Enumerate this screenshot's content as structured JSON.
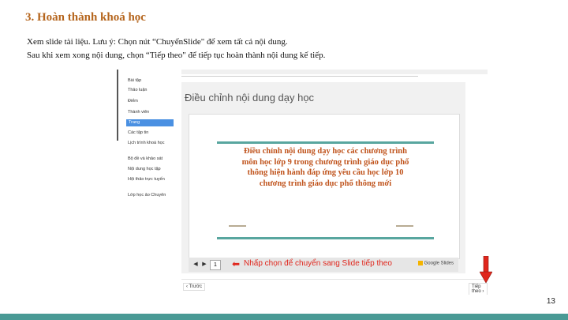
{
  "slide": {
    "title": "3. Hoàn thành khoá học",
    "instruction_1": "Xem slide tài liệu. Lưu ý: Chọn nút “ChuyểnSlide\" để xem tất cả nội dung.",
    "instruction_2": "Sau khi xem xong nội dung, chọn “Tiếp theo\" để tiếp tục hoàn thành nội dung kế tiếp.",
    "page_number": "13"
  },
  "sidebar": {
    "items": [
      "Bài tập",
      "Thảo luận",
      "Điểm",
      "Thành viên",
      "Trang",
      "Các tập tin",
      "Lịch trình khoá học",
      "Bộ đề và khảo sát",
      "Nội dung học tập",
      "Hội thảo trực tuyến",
      "Lớp học ảo Chuyên"
    ],
    "active_index": 4
  },
  "content": {
    "title": "Điều chỉnh nội dung dạy học",
    "lesson_title": "Điều chỉnh nội dung dạy học các chương trình\nmôn học lớp 9 trong chương trình giáo dục phổ\nthông hiện hành đáp ứng yêu cầu học lớp 10\nchương trình giáo dục phổ thông mới",
    "page_current": "1",
    "hint": "Nhấp chọn để chuyển sang Slide tiếp theo",
    "google_slides_label": "Google Slides",
    "prev_label": "‹ Trước",
    "next_label": "Tiếp theo ›"
  },
  "colors": {
    "title": "#b5651d",
    "accent_teal": "#58a69f",
    "hint_red": "#e0261c",
    "bottom_bar": "#4a9a95"
  }
}
